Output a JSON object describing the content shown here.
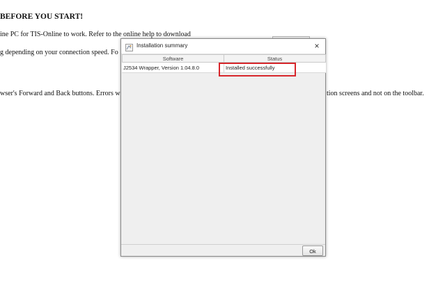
{
  "background_page": {
    "heading": "BEFORE YOU START!",
    "lines": [
      "ine PC for TIS-Online to work. Refer to the online help to download",
      "g depending on your connection speed. Fo",
      "wser's Forward and Back buttons. Errors w",
      "tion screens and not on the toolbar."
    ]
  },
  "dialog": {
    "title": "Installation summary",
    "close_symbol": "×",
    "columns": [
      "Software",
      "Status"
    ],
    "rows": [
      {
        "software": "J2534 Wrapper, Version 1.04.8.0",
        "status": "Installed successfully"
      }
    ],
    "ok_label": "Ok",
    "highlight_color": "#d7262b"
  }
}
